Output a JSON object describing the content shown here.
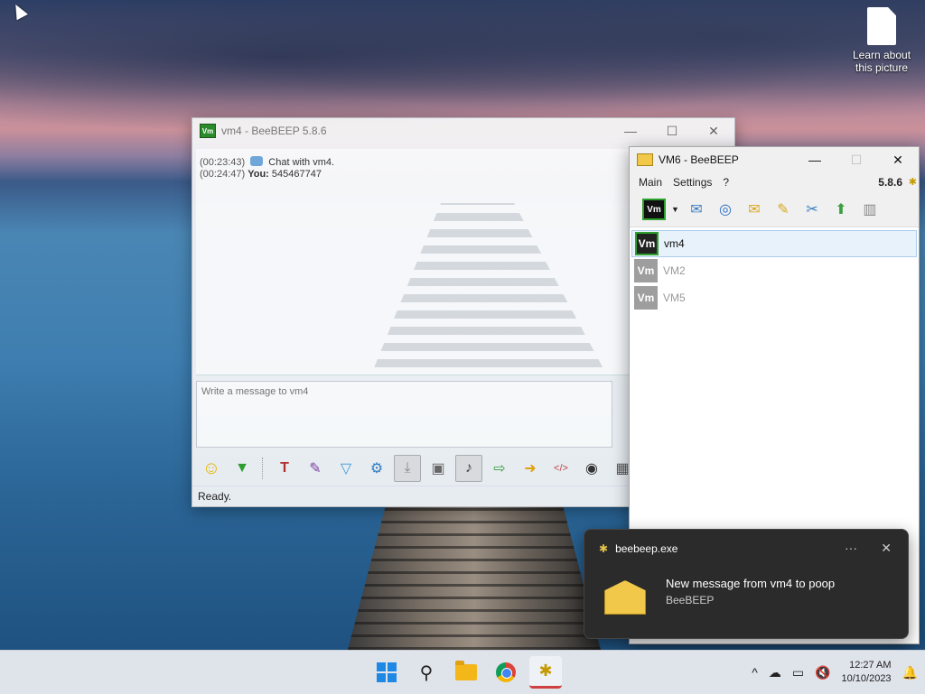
{
  "desktop": {
    "icon_label": "Learn about this picture"
  },
  "chat_window": {
    "title": "vm4 - BeeBEEP 5.8.6",
    "app_icon_text": "Vm",
    "controls": {
      "minimize": "—",
      "maximize": "☐",
      "close": "✕"
    },
    "messages": [
      {
        "time": "(00:23:43)",
        "text": "Chat with vm4."
      },
      {
        "time": "(00:24:47)",
        "sender": "You:",
        "text": "545467747"
      }
    ],
    "input_placeholder": "Write a message to vm4",
    "status": "Ready."
  },
  "contacts_window": {
    "title": "VM6 - BeeBEEP",
    "controls": {
      "minimize": "—",
      "maximize": "☐",
      "close": "✕"
    },
    "menu": [
      "Main",
      "Settings",
      "?"
    ],
    "version": "5.8.6",
    "badge_text": "Vm",
    "users": [
      {
        "avatar": "Vm",
        "name": "vm4",
        "selected": true
      },
      {
        "avatar": "Vm",
        "name": "VM2",
        "selected": false
      },
      {
        "avatar": "Vm",
        "name": "VM5",
        "selected": false
      }
    ]
  },
  "notification": {
    "app": "beebeep.exe",
    "more": "···",
    "close": "✕",
    "message": "New message from vm4 to poop",
    "source": "BeeBEEP"
  },
  "taskbar": {
    "time": "12:27 AM",
    "date": "10/10/2023",
    "tray_chevron": "^"
  }
}
